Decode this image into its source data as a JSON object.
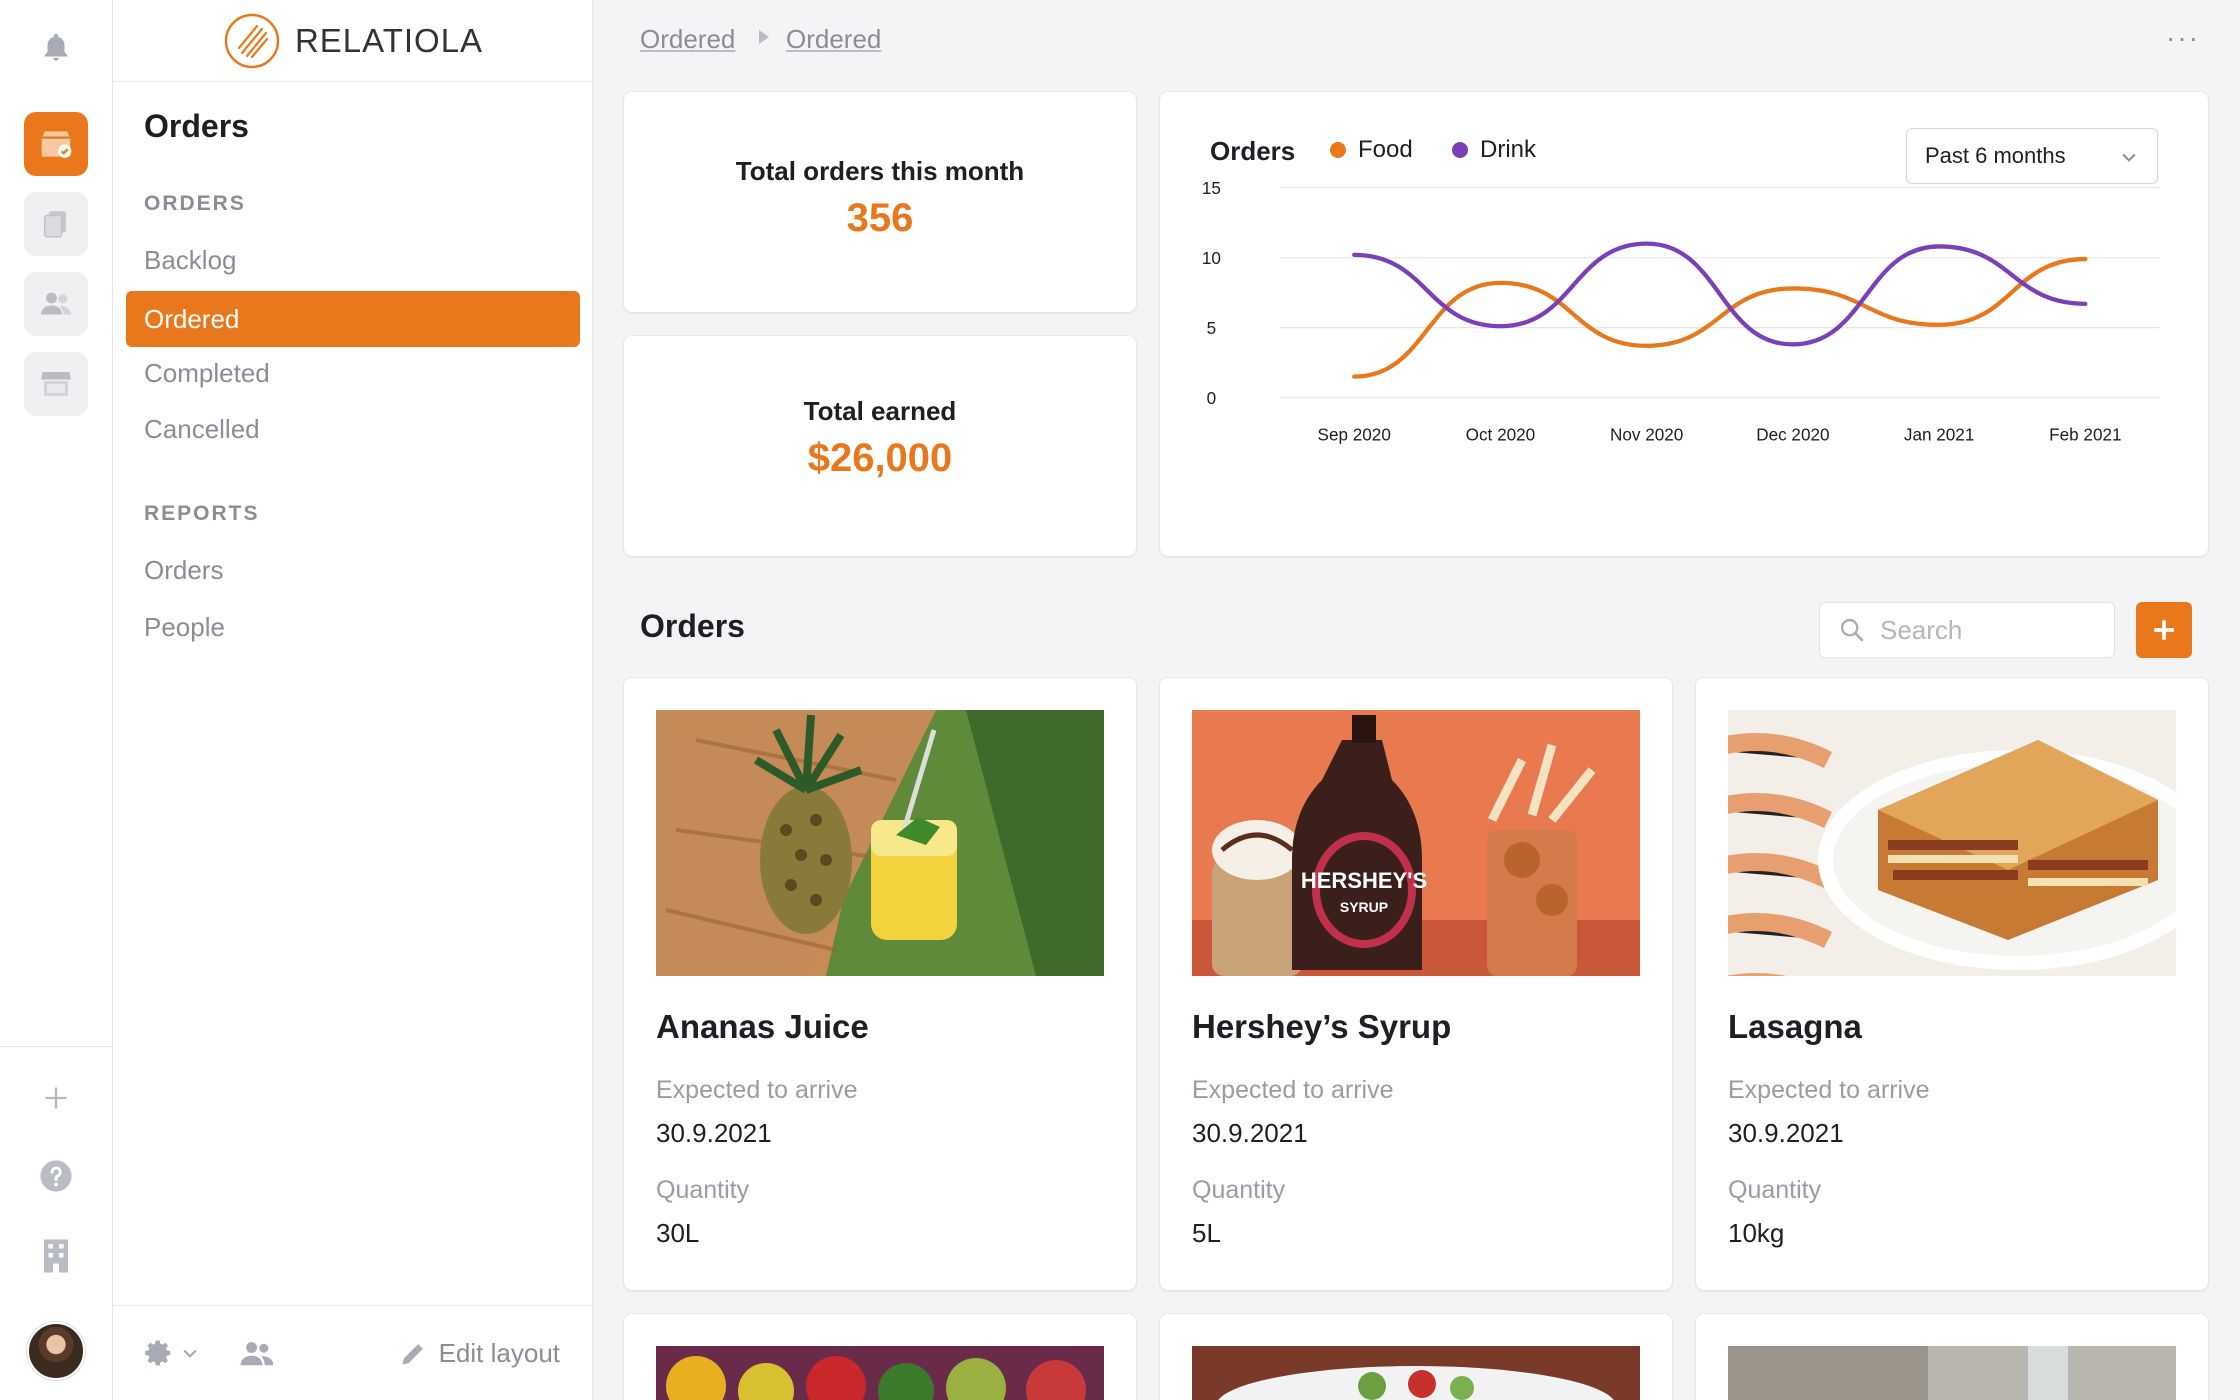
{
  "brand": {
    "name": "RELATIOLA"
  },
  "sidebar": {
    "title": "Orders",
    "sections": [
      {
        "label": "ORDERS",
        "items": [
          "Backlog",
          "Ordered",
          "Completed",
          "Cancelled"
        ],
        "active": "Ordered"
      },
      {
        "label": "REPORTS",
        "items": [
          "Orders",
          "People"
        ]
      }
    ],
    "footer": {
      "edit_layout": "Edit layout"
    }
  },
  "breadcrumb": [
    "Ordered",
    "Ordered"
  ],
  "stats": {
    "orders_label": "Total orders this month",
    "orders_value": "356",
    "earned_label": "Total earned",
    "earned_value": "$26,000"
  },
  "chart_panel": {
    "title": "Orders",
    "range_select": "Past 6 months"
  },
  "chart_data": {
    "type": "line",
    "title": "Orders",
    "categories": [
      "Sep 2020",
      "Oct 2020",
      "Nov 2020",
      "Dec 2020",
      "Jan 2021",
      "Feb 2021"
    ],
    "series": [
      {
        "name": "Food",
        "color": "#e8781b",
        "values": [
          1.5,
          8.2,
          3.7,
          7.8,
          5.2,
          9.9
        ]
      },
      {
        "name": "Drink",
        "color": "#7b3fb8",
        "values": [
          10.2,
          5.1,
          11.0,
          3.8,
          10.8,
          6.7
        ]
      }
    ],
    "ylim": [
      0,
      15
    ],
    "yticks": [
      0,
      5,
      10,
      15
    ],
    "grid": true,
    "legend": "top-left",
    "xlabel": "",
    "ylabel": ""
  },
  "orders_section": {
    "title": "Orders",
    "search_placeholder": "Search"
  },
  "orders": [
    {
      "name": "Ananas Juice",
      "expected_label": "Expected to arrive",
      "expected": "30.9.2021",
      "quantity_label": "Quantity",
      "quantity": "30L"
    },
    {
      "name": "Hershey’s Syrup",
      "expected_label": "Expected to arrive",
      "expected": "30.9.2021",
      "quantity_label": "Quantity",
      "quantity": "5L"
    },
    {
      "name": "Lasagna",
      "expected_label": "Expected to arrive",
      "expected": "30.9.2021",
      "quantity_label": "Quantity",
      "quantity": "10kg"
    }
  ],
  "product_image_text": {
    "syrup_brand": "HERSHEY'S",
    "syrup_word": "SYRUP"
  },
  "colors": {
    "accent": "#e8781b",
    "drink": "#7b3fb8",
    "muted": "#8a8d96"
  }
}
